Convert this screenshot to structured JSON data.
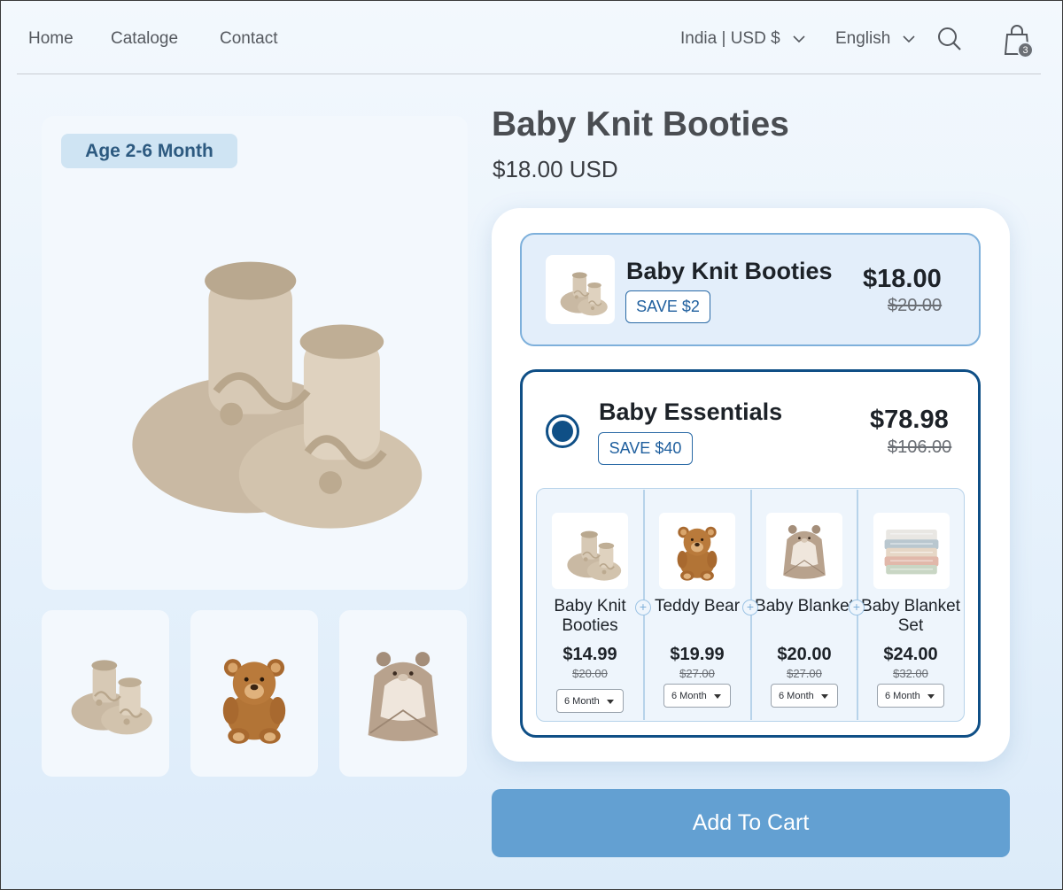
{
  "nav": {
    "links": [
      "Home",
      "Cataloge",
      "Contact"
    ],
    "region": "India | USD $",
    "language": "English",
    "cart_count": "3"
  },
  "gallery": {
    "age_badge": "Age 2-6 Month"
  },
  "product": {
    "title": "Baby Knit Booties",
    "price": "$18.00 USD"
  },
  "options": [
    {
      "name": "Baby Knit Booties",
      "save": "SAVE $2",
      "price": "$18.00",
      "old_price": "$20.00"
    },
    {
      "name": "Baby Essentials",
      "save": "SAVE $40",
      "price": "$78.98",
      "old_price": "$106.00",
      "selected": true,
      "items": [
        {
          "name": "Baby Knit Booties",
          "price": "$14.99",
          "old_price": "$20.00",
          "size": "6 Month"
        },
        {
          "name": "Teddy Bear",
          "price": "$19.99",
          "old_price": "$27.00",
          "size": "6 Month"
        },
        {
          "name": "Baby Blanket",
          "price": "$20.00",
          "old_price": "$27.00",
          "size": "6 Month"
        },
        {
          "name": "Baby Blanket Set",
          "price": "$24.00",
          "old_price": "$32.00",
          "size": "6 Month"
        }
      ]
    }
  ],
  "cta": "Add To Cart",
  "colors": {
    "accent": "#0f4f86",
    "button": "#63a0d2",
    "badge_bg": "#cfe4f3"
  }
}
